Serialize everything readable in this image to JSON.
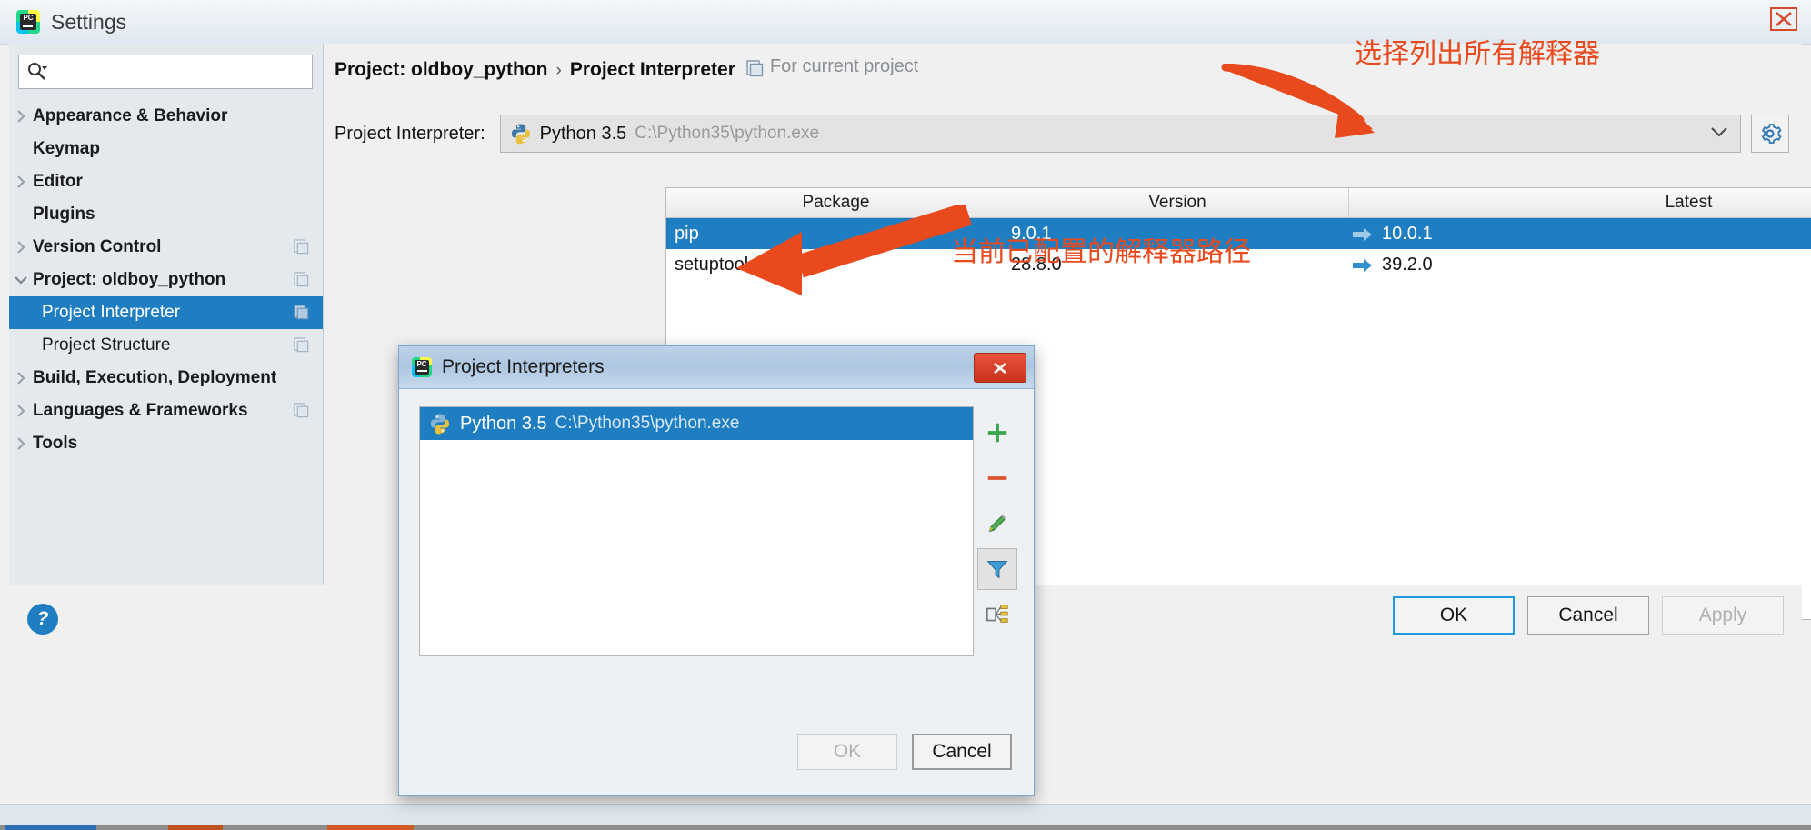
{
  "window": {
    "title": "Settings",
    "logo_icon": "pycharm-logo-icon",
    "close_icon": "close-icon"
  },
  "sidebar": {
    "search": {
      "placeholder": "",
      "value": "",
      "icon": "search-icon",
      "dropdown_icon": "chevron-down-icon"
    },
    "items": [
      {
        "label": "Appearance & Behavior",
        "level": 1,
        "expandable": true,
        "expanded": false,
        "selected": false,
        "badge": false
      },
      {
        "label": "Keymap",
        "level": 1,
        "expandable": false,
        "expanded": false,
        "selected": false,
        "badge": false
      },
      {
        "label": "Editor",
        "level": 1,
        "expandable": true,
        "expanded": false,
        "selected": false,
        "badge": false
      },
      {
        "label": "Plugins",
        "level": 1,
        "expandable": false,
        "expanded": false,
        "selected": false,
        "badge": false
      },
      {
        "label": "Version Control",
        "level": 1,
        "expandable": true,
        "expanded": false,
        "selected": false,
        "badge": true
      },
      {
        "label": "Project: oldboy_python",
        "level": 1,
        "expandable": true,
        "expanded": true,
        "selected": false,
        "badge": true
      },
      {
        "label": "Project Interpreter",
        "level": 2,
        "expandable": false,
        "expanded": false,
        "selected": true,
        "badge": true
      },
      {
        "label": "Project Structure",
        "level": 2,
        "expandable": false,
        "expanded": false,
        "selected": false,
        "badge": true
      },
      {
        "label": "Build, Execution, Deployment",
        "level": 1,
        "expandable": true,
        "expanded": false,
        "selected": false,
        "badge": false
      },
      {
        "label": "Languages & Frameworks",
        "level": 1,
        "expandable": true,
        "expanded": false,
        "selected": false,
        "badge": true
      },
      {
        "label": "Tools",
        "level": 1,
        "expandable": true,
        "expanded": false,
        "selected": false,
        "badge": false
      }
    ]
  },
  "main": {
    "breadcrumb": {
      "project": "Project: oldboy_python",
      "separator": "›",
      "page": "Project Interpreter",
      "scope_icon": "copy-settings-icon",
      "scope": "For current project"
    },
    "interpreter": {
      "label": "Project Interpreter:",
      "icon": "python-icon",
      "name": "Python 3.5",
      "path": "C:\\Python35\\python.exe",
      "dropdown_icon": "chevron-down-icon",
      "gear_icon": "gear-icon"
    },
    "packages": {
      "columns": [
        "Package",
        "Version",
        "Latest"
      ],
      "rows": [
        {
          "package": "pip",
          "version": "9.0.1",
          "latest": "10.0.1",
          "selected": true,
          "upgrade_icon": "arrow-right-icon"
        },
        {
          "package": "setuptools",
          "version": "28.8.0",
          "latest": "39.2.0",
          "selected": false,
          "upgrade_icon": "arrow-right-icon"
        }
      ],
      "toolbar": [
        {
          "name": "add-package-button",
          "icon": "plus-icon"
        },
        {
          "name": "remove-package-button",
          "icon": "minus-icon"
        },
        {
          "name": "upgrade-package-button",
          "icon": "arrow-up-icon"
        }
      ]
    }
  },
  "footer": {
    "help_icon": "help-icon",
    "ok_label": "OK",
    "cancel_label": "Cancel",
    "apply_label": "Apply"
  },
  "modal": {
    "title": "Project Interpreters",
    "logo_icon": "pycharm-logo-icon",
    "close_icon": "close-icon",
    "list": [
      {
        "icon": "python-icon",
        "name": "Python 3.5",
        "path": "C:\\Python35\\python.exe",
        "selected": true
      }
    ],
    "toolbar": [
      {
        "name": "add-interpreter-button",
        "icon": "plus-icon",
        "active": false
      },
      {
        "name": "remove-interpreter-button",
        "icon": "minus-icon",
        "active": false
      },
      {
        "name": "edit-interpreter-button",
        "icon": "pencil-icon",
        "active": false
      },
      {
        "name": "filter-interpreters-button",
        "icon": "funnel-icon",
        "active": true
      },
      {
        "name": "show-paths-button",
        "icon": "tree-structure-icon",
        "active": false
      }
    ],
    "ok_label": "OK",
    "cancel_label": "Cancel"
  },
  "annotations": [
    {
      "id": "anno1",
      "text": "选择列出所有解释器"
    },
    {
      "id": "anno2",
      "text": "当前已配置的解释器路径"
    }
  ],
  "colors": {
    "accent": "#1f7ec2",
    "annotation": "#e8491d",
    "sidebar_bg": "#e4e9ee",
    "panel_bg": "#f0f0f0"
  }
}
